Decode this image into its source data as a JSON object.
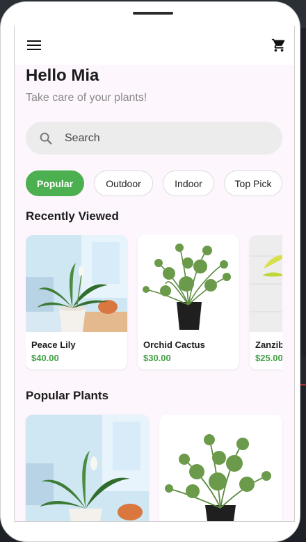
{
  "app": {
    "greeting": "Hello Mia",
    "subtitle": "Take care of your plants!",
    "search_placeholder": "Search",
    "icons": {
      "menu": "menu-icon",
      "cart": "cart-icon",
      "search": "search-icon"
    },
    "colors": {
      "accent": "#4caf50",
      "price": "#43a047",
      "screen_bg": "#fdf6fd"
    }
  },
  "categories": [
    {
      "label": "Popular",
      "active": true
    },
    {
      "label": "Outdoor",
      "active": false
    },
    {
      "label": "Indoor",
      "active": false
    },
    {
      "label": "Top Pick",
      "active": false
    }
  ],
  "recently_viewed": {
    "title": "Recently Viewed",
    "items": [
      {
        "name": "Peace Lily",
        "price": "$40.00"
      },
      {
        "name": "Orchid Cactus",
        "price": "$30.00"
      },
      {
        "name": "Zanzibar",
        "price": "$25.00"
      }
    ]
  },
  "popular_plants": {
    "title": "Popular Plants"
  }
}
